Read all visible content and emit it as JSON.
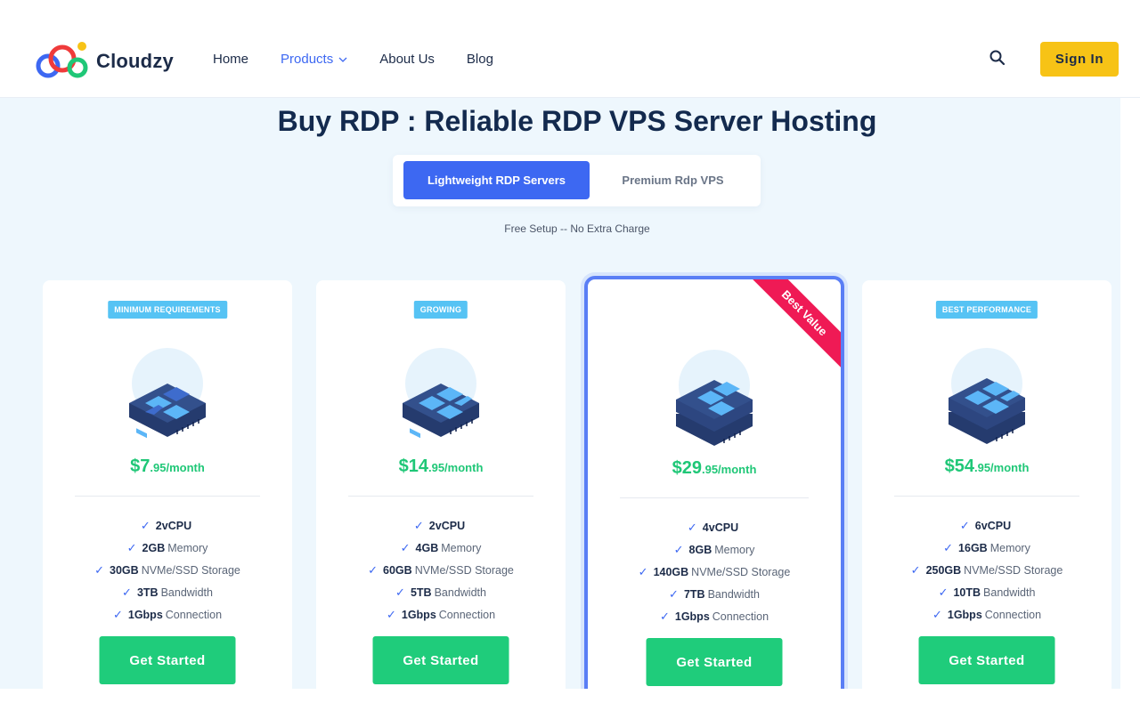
{
  "header": {
    "brand": "Cloudzy",
    "nav": [
      {
        "label": "Home"
      },
      {
        "label": "Products"
      },
      {
        "label": "About Us"
      },
      {
        "label": "Blog"
      }
    ],
    "sign_in_label": "Sign In",
    "icons": {
      "search": "search-icon",
      "products_dropdown": "chevron-down-icon"
    }
  },
  "main": {
    "title": "Buy RDP : Reliable RDP VPS Server Hosting",
    "tabs": [
      {
        "label": "Lightweight RDP Servers",
        "active": true
      },
      {
        "label": "Premium Rdp VPS",
        "active": false
      }
    ],
    "note": "Free Setup -- No Extra Charge",
    "plans": [
      {
        "badge": "MINIMUM REQUIREMENTS",
        "price_main": "$7",
        "price_rest": ".95/month",
        "features": [
          {
            "value": "2vCPU",
            "label": ""
          },
          {
            "value": "2GB",
            "label": "Memory"
          },
          {
            "value": "30GB",
            "label": "NVMe/SSD Storage"
          },
          {
            "value": "3TB",
            "label": "Bandwidth"
          },
          {
            "value": "1Gbps",
            "label": "Connection"
          }
        ],
        "cta": "Get Started"
      },
      {
        "badge": "GROWING",
        "price_main": "$14",
        "price_rest": ".95/month",
        "features": [
          {
            "value": "2vCPU",
            "label": ""
          },
          {
            "value": "4GB",
            "label": "Memory"
          },
          {
            "value": "60GB",
            "label": "NVMe/SSD Storage"
          },
          {
            "value": "5TB",
            "label": "Bandwidth"
          },
          {
            "value": "1Gbps",
            "label": "Connection"
          }
        ],
        "cta": "Get Started"
      },
      {
        "ribbon": "Best Value",
        "price_main": "$29",
        "price_rest": ".95/month",
        "features": [
          {
            "value": "4vCPU",
            "label": ""
          },
          {
            "value": "8GB",
            "label": "Memory"
          },
          {
            "value": "140GB",
            "label": "NVMe/SSD Storage"
          },
          {
            "value": "7TB",
            "label": "Bandwidth"
          },
          {
            "value": "1Gbps",
            "label": "Connection"
          }
        ],
        "cta": "Get Started"
      },
      {
        "badge": "BEST PERFORMANCE",
        "price_main": "$54",
        "price_rest": ".95/month",
        "features": [
          {
            "value": "6vCPU",
            "label": ""
          },
          {
            "value": "16GB",
            "label": "Memory"
          },
          {
            "value": "250GB",
            "label": "NVMe/SSD Storage"
          },
          {
            "value": "10TB",
            "label": "Bandwidth"
          },
          {
            "value": "1Gbps",
            "label": "Connection"
          }
        ],
        "cta": "Get Started"
      }
    ]
  },
  "colors": {
    "accent": "#3d68f2",
    "cta": "#1fcc7b",
    "price": "#1fc777",
    "sign_in": "#f7c316",
    "badge": "#56c3f4",
    "ribbon": "#ef1a55",
    "page_bg": "#eef7fd"
  }
}
